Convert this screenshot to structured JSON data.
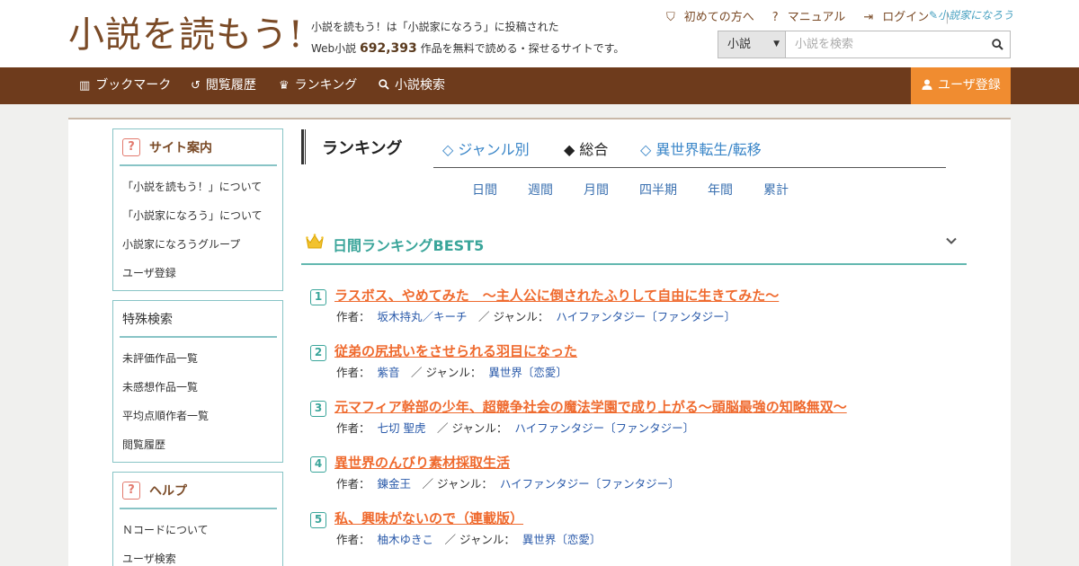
{
  "header": {
    "logo_text": "小説を読もう!",
    "desc_line1": "小説を読もう！は「小説家になろう」に投稿された",
    "desc_prefix": "Web小説",
    "desc_count": "692,393",
    "desc_suffix": "作品を無料で読める・探せるサイトです。",
    "links": [
      "初めての方へ",
      "マニュアル",
      "ログイン"
    ],
    "narou_logo": "小説家になろう",
    "search_select": "小説",
    "search_placeholder": "小説を検索"
  },
  "nav": {
    "items": [
      "ブックマーク",
      "閲覧履歴",
      "ランキング",
      "小説検索"
    ],
    "register": "ユーザ登録"
  },
  "sidebar": {
    "site_guide": {
      "title": "サイト案内",
      "items": [
        "「小説を読もう！」について",
        "「小説家になろう」について",
        "小説家になろうグループ",
        "ユーザ登録"
      ]
    },
    "special_search": {
      "title": "特殊検索",
      "items": [
        "未評価作品一覧",
        "未感想作品一覧",
        "平均点順作者一覧",
        "閲覧履歴"
      ]
    },
    "help": {
      "title": "ヘルプ",
      "items": [
        "Ｎコードについて",
        "ユーザ検索"
      ]
    }
  },
  "ranking": {
    "title": "ランキング",
    "tabs": [
      "◇ ジャンル別",
      "◆ 総合",
      "◇ 異世界転生/転移"
    ],
    "periods": [
      "日間",
      "週間",
      "月間",
      "四半期",
      "年間",
      "累計"
    ],
    "best_title": "日間ランキングBEST5",
    "author_label": "作者：",
    "genre_label": "ジャンル：",
    "entries": [
      {
        "num": "1",
        "title": "ラスボス、やめてみた　～主人公に倒されたふりして自由に生きてみた～",
        "author": "坂木持丸／キーチ",
        "genre": "ハイファンタジー〔ファンタジー〕"
      },
      {
        "num": "2",
        "title": "従弟の尻拭いをさせられる羽目になった",
        "author": "紫音",
        "genre": "異世界〔恋愛〕"
      },
      {
        "num": "3",
        "title": "元マフィア幹部の少年、超競争社会の魔法学園で成り上がる～頭脳最強の知略無双～",
        "author": "七切 聖虎",
        "genre": "ハイファンタジー〔ファンタジー〕"
      },
      {
        "num": "4",
        "title": "異世界のんびり素材採取生活",
        "author": "錬金王",
        "genre": "ハイファンタジー〔ファンタジー〕"
      },
      {
        "num": "5",
        "title": "私、興味がないので（連載版）",
        "author": "柚木ゆきこ",
        "genre": "異世界〔恋愛〕"
      }
    ]
  }
}
